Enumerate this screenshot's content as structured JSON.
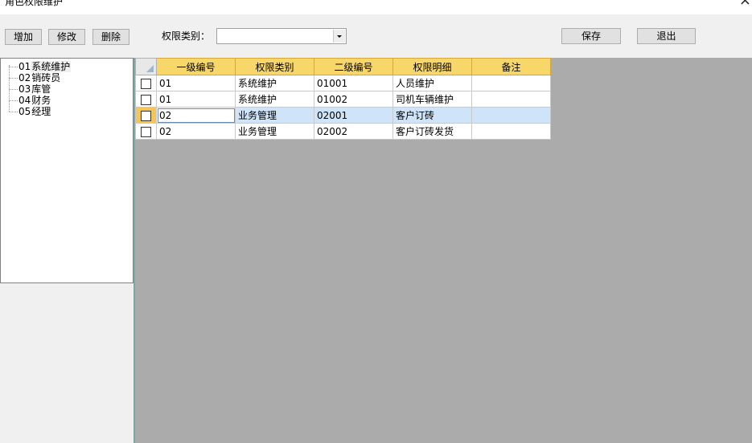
{
  "window": {
    "title": "角色权限维护",
    "close_glyph": "×"
  },
  "toolbar": {
    "add_label": "增加",
    "edit_label": "修改",
    "delete_label": "删除",
    "type_label": "权限类别：",
    "type_value": "",
    "save_label": "保存",
    "exit_label": "退出"
  },
  "tree": {
    "items": [
      {
        "code": "01",
        "name": "系统维护",
        "selected": true
      },
      {
        "code": "02",
        "name": "销砖员",
        "selected": false
      },
      {
        "code": "03",
        "name": "库管",
        "selected": false
      },
      {
        "code": "04",
        "name": "财务",
        "selected": false
      },
      {
        "code": "05",
        "name": "经理",
        "selected": false
      }
    ]
  },
  "grid": {
    "columns": [
      "一级编号",
      "权限类别",
      "二级编号",
      "权限明细",
      "备注"
    ],
    "rows": [
      {
        "level1": "01",
        "category": "系统维护",
        "level2": "01001",
        "detail": "人员维护",
        "remark": ""
      },
      {
        "level1": "01",
        "category": "系统维护",
        "level2": "01002",
        "detail": "司机车辆维护",
        "remark": ""
      },
      {
        "level1": "02",
        "category": "业务管理",
        "level2": "02001",
        "detail": "客户订砖",
        "remark": ""
      },
      {
        "level1": "02",
        "category": "业务管理",
        "level2": "02002",
        "detail": "客户订砖发货",
        "remark": ""
      }
    ],
    "current_row": 2
  },
  "colors": {
    "header": "#f7d76a",
    "selection": "#cfe4f9",
    "background": "#ababab"
  }
}
